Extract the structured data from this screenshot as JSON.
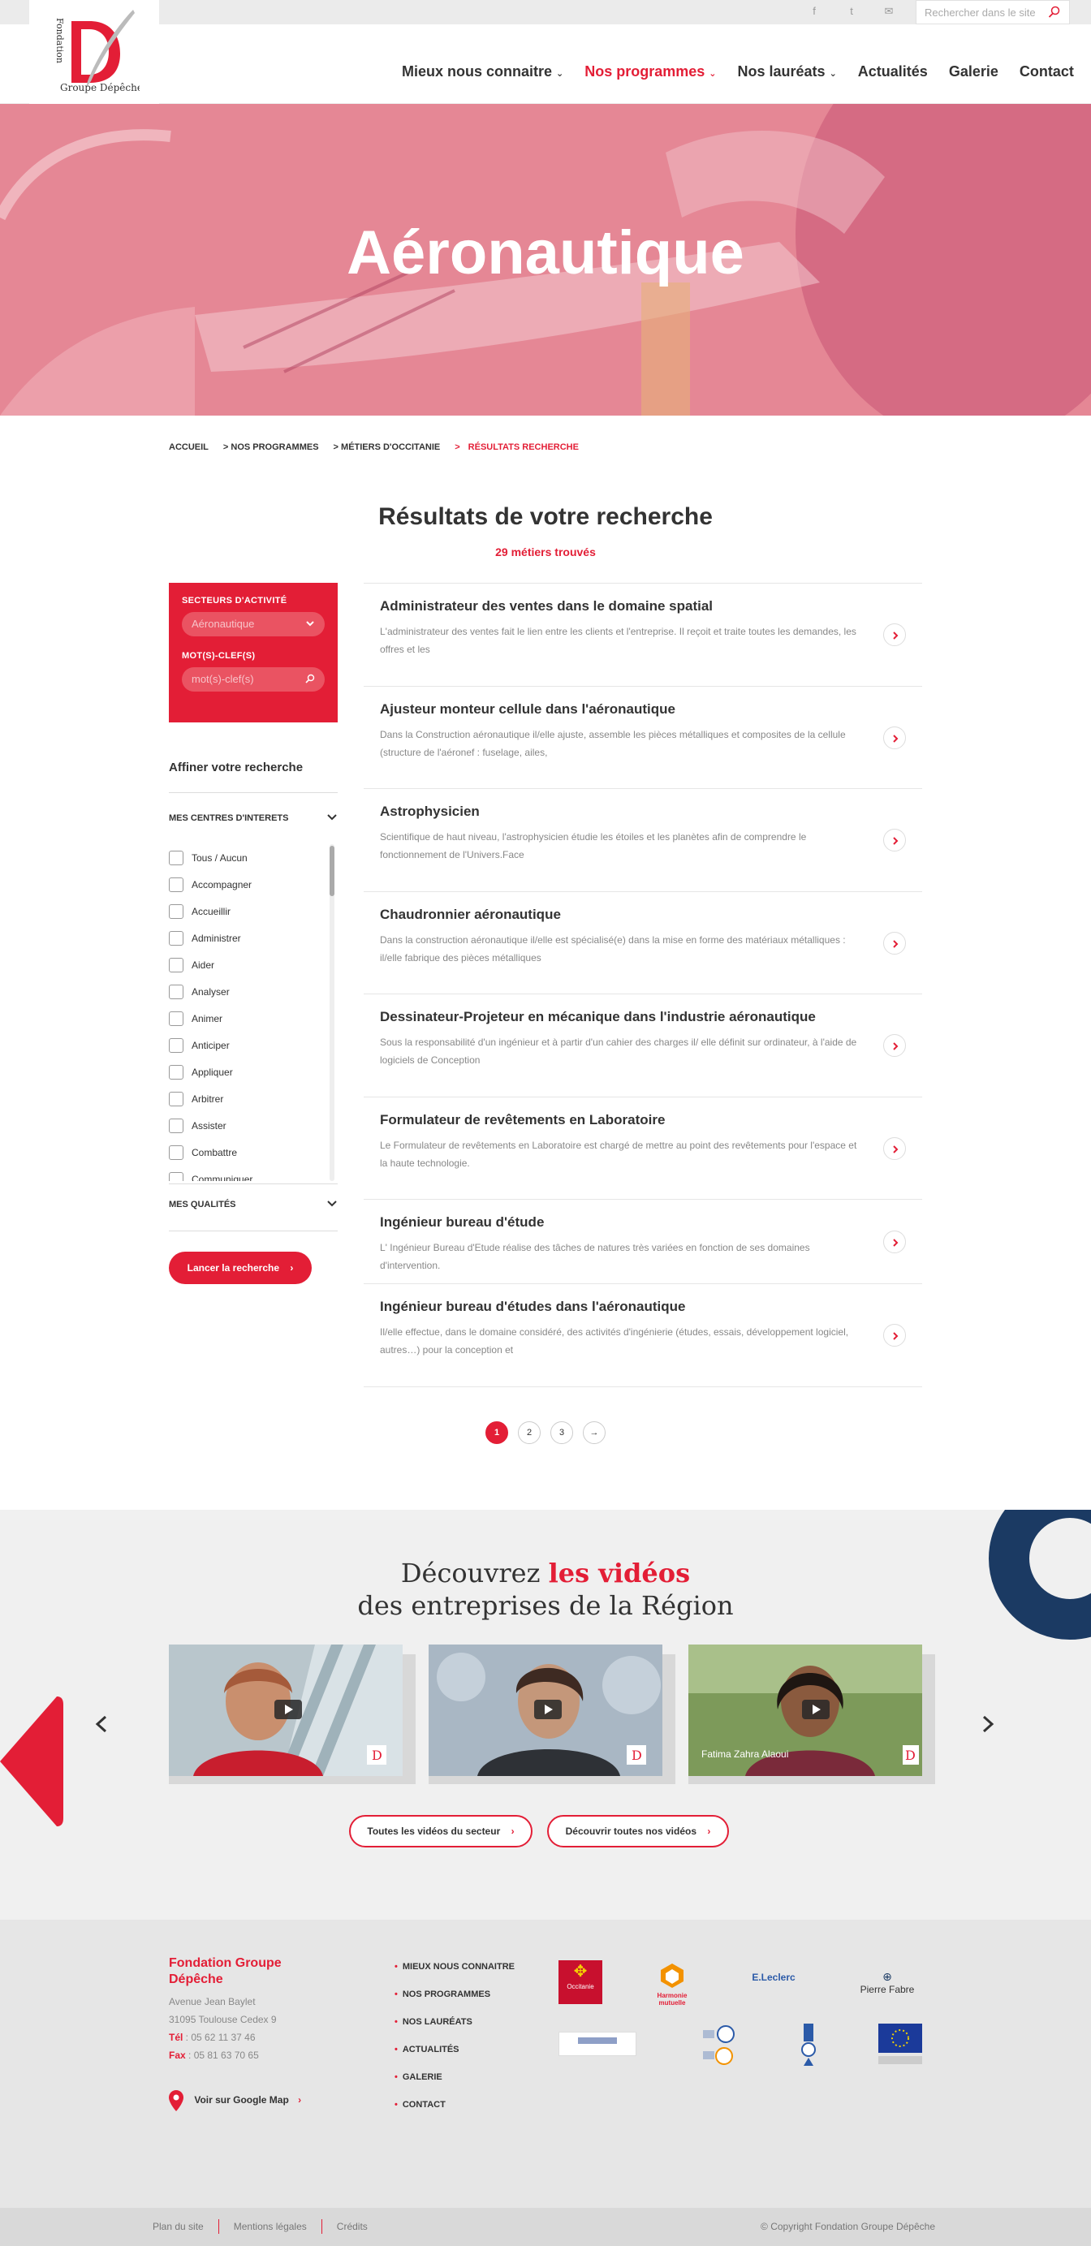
{
  "site": {
    "logo_text_top": "Fondation",
    "logo_text_bottom": "Groupe Dépêche",
    "search_placeholder": "Rechercher dans le site"
  },
  "topbar": {
    "icons": [
      "facebook-icon",
      "twitter-icon",
      "mail-icon"
    ]
  },
  "nav": {
    "items": [
      {
        "label": "Mieux nous connaitre",
        "has_dropdown": true,
        "active": false
      },
      {
        "label": "Nos programmes",
        "has_dropdown": true,
        "active": true
      },
      {
        "label": "Nos lauréats",
        "has_dropdown": true,
        "active": false
      },
      {
        "label": "Actualités",
        "has_dropdown": false,
        "active": false
      },
      {
        "label": "Galerie",
        "has_dropdown": false,
        "active": false
      },
      {
        "label": "Contact",
        "has_dropdown": false,
        "active": false
      }
    ]
  },
  "hero": {
    "title": "Aéronautique"
  },
  "breadcrumb": {
    "items": [
      "ACCUEIL",
      "> NOS PROGRAMMES",
      "> MÉTIERS D'OCCITANIE",
      ">",
      "RÉSULTATS RECHERCHE"
    ]
  },
  "results": {
    "title": "Résultats de votre recherche",
    "count": "29 métiers trouvés"
  },
  "filters": {
    "sector_label": "SECTEURS D'ACTIVITÉ",
    "sector_value": "Aéronautique",
    "keyword_label": "MOT(S)-CLEF(S)",
    "keyword_placeholder": "mot(s)-clef(s)",
    "refine_title": "Affiner votre recherche",
    "interests_label": "MES CENTRES D'INTERETS",
    "qualities_label": "MES QUALITÉS",
    "launch_label": "Lancer la recherche",
    "interests": [
      "Tous / Aucun",
      "Accompagner",
      "Accueillir",
      "Administrer",
      "Aider",
      "Analyser",
      "Animer",
      "Anticiper",
      "Appliquer",
      "Arbitrer",
      "Assister",
      "Combattre",
      "Communiquer"
    ]
  },
  "jobs": [
    {
      "title": "Administrateur des ventes dans le domaine spatial",
      "desc": "L'administrateur des ventes fait le lien entre les clients et l'entreprise. Il reçoit et traite toutes les demandes, les offres et les"
    },
    {
      "title": "Ajusteur monteur cellule dans l'aéronautique",
      "desc": "Dans la Construction aéronautique il/elle ajuste, assemble les pièces métalliques et composites de la cellule (structure de l'aéronef : fuselage, ailes,"
    },
    {
      "title": "Astrophysicien",
      "desc": "Scientifique de haut niveau, l'astrophysicien étudie les étoiles et les planètes afin de comprendre le fonctionnement de l'Univers.Face"
    },
    {
      "title": "Chaudronnier aéronautique",
      "desc": "Dans la construction aéronautique il/elle est spécialisé(e) dans la mise en forme des matériaux métalliques : il/elle fabrique des pièces métalliques"
    },
    {
      "title": "Dessinateur-Projeteur en mécanique dans l'industrie aéronautique",
      "desc": "Sous la responsabilité d'un ingénieur et à partir d'un cahier des charges il/ elle définit sur ordinateur, à l'aide de logiciels de Conception"
    },
    {
      "title": "Formulateur de revêtements en Laboratoire",
      "desc": "Le Formulateur de revêtements en Laboratoire est chargé de mettre au point des revêtements pour l'espace et la haute technologie."
    },
    {
      "title": "Ingénieur bureau d'étude",
      "desc": "L' Ingénieur Bureau d'Etude réalise des tâches de natures très variées en fonction de ses domaines d'intervention."
    },
    {
      "title": "Ingénieur bureau d'études dans l'aéronautique",
      "desc": "Il/elle effectue, dans le domaine considéré, des activités d'ingénierie (études, essais, développement logiciel, autres…) pour la conception et"
    }
  ],
  "pagination": {
    "pages": [
      "1",
      "2",
      "3"
    ],
    "next": "→",
    "current": 1
  },
  "videos": {
    "title_prefix": "Découvrez",
    "title_highlight": "les vidéos",
    "title_line2": "des entreprises de la Région",
    "captions": [
      "",
      "",
      "Fatima Zahra Alaoui"
    ],
    "btn_sector": "Toutes les vidéos du secteur",
    "btn_all": "Découvrir toutes nos vidéos"
  },
  "footer": {
    "name": "Fondation Groupe Dépêche",
    "address1": "Avenue Jean Baylet",
    "address2": "31095 Toulouse Cedex 9",
    "tel_label": "Tél",
    "tel": " : 05 62 11 37 46",
    "fax_label": "Fax",
    "fax": " : 05 81 63 70 65",
    "map_label": "Voir sur Google Map",
    "links": [
      "MIEUX NOUS CONNAITRE",
      "NOS PROGRAMMES",
      "NOS LAURÉATS",
      "ACTUALITÉS",
      "GALERIE",
      "CONTACT"
    ],
    "partners": [
      "Occitanie",
      "Harmonie mutuelle",
      "E.Leclerc",
      "Pierre Fabre"
    ]
  },
  "bottom": {
    "links": [
      "Plan du site",
      "Mentions légales",
      "Crédits"
    ],
    "copyright": "© Copyright Fondation Groupe Dépêche"
  },
  "colors": {
    "accent": "#e31e36",
    "navy": "#1b3a63"
  }
}
